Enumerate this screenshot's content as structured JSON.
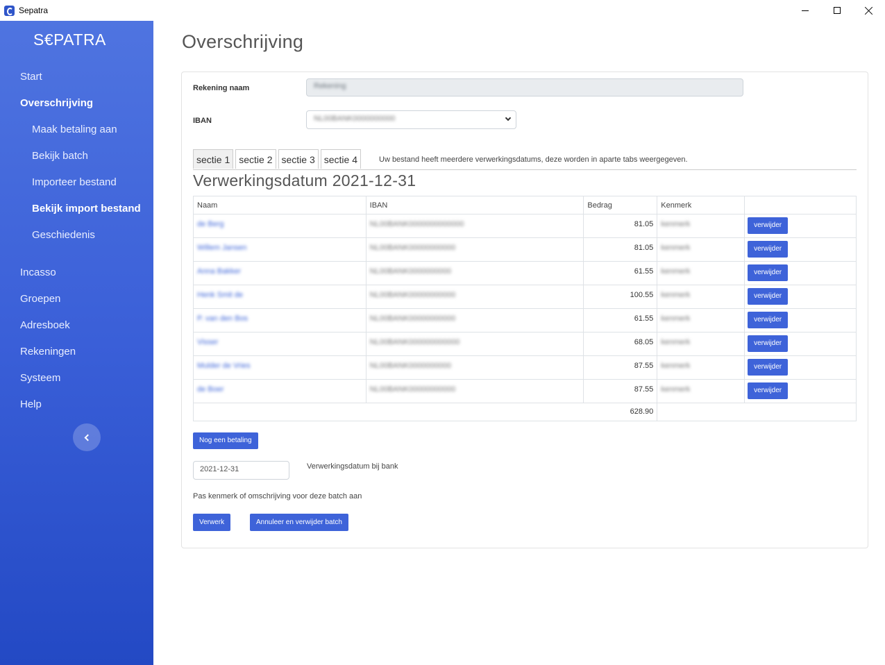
{
  "window": {
    "title": "Sepatra"
  },
  "sidebar": {
    "brand": "S€PATRA",
    "items": [
      {
        "label": "Start"
      },
      {
        "label": "Overschrijving"
      },
      {
        "label": "Maak betaling aan"
      },
      {
        "label": "Bekijk batch"
      },
      {
        "label": "Importeer bestand"
      },
      {
        "label": "Bekijk import bestand"
      },
      {
        "label": "Geschiedenis"
      },
      {
        "label": "Incasso"
      },
      {
        "label": "Groepen"
      },
      {
        "label": "Adresboek"
      },
      {
        "label": "Rekeningen"
      },
      {
        "label": "Systeem"
      },
      {
        "label": "Help"
      }
    ],
    "active_item": "Bekijk import bestand",
    "collapse_icon": "chevron-left-icon"
  },
  "main": {
    "title": "Overschrijving",
    "account": {
      "name_label": "Rekening naam",
      "name_value": "Rekening",
      "iban_label": "IBAN",
      "iban_value": "NL00BANK0000000000"
    },
    "tabs": [
      {
        "label": "sectie 1"
      },
      {
        "label": "sectie 2"
      },
      {
        "label": "sectie 3"
      },
      {
        "label": "sectie 4"
      }
    ],
    "tabs_note": "Uw bestand heeft meerdere verwerkingsdatums, deze worden in aparte tabs weergegeven.",
    "section_title": "Verwerkingsdatum 2021-12-31",
    "table": {
      "headers": [
        "Naam",
        "IBAN",
        "Bedrag",
        "Kenmerk",
        ""
      ],
      "rows": [
        {
          "naam": "de Berg",
          "iban": "NL00BANK0000000000000",
          "bedrag": "81.05",
          "kenmerk": "kenmerk",
          "action": "verwijder"
        },
        {
          "naam": "Willem Jansen",
          "iban": "NL00BANK00000000000",
          "bedrag": "81.05",
          "kenmerk": "kenmerk",
          "action": "verwijder"
        },
        {
          "naam": "Anna Bakker",
          "iban": "NL00BANK0000000000",
          "bedrag": "61.55",
          "kenmerk": "kenmerk",
          "action": "verwijder"
        },
        {
          "naam": "Henk Smit de",
          "iban": "NL00BANK00000000000",
          "bedrag": "100.55",
          "kenmerk": "kenmerk",
          "action": "verwijder"
        },
        {
          "naam": "P. van den Bos",
          "iban": "NL00BANK00000000000",
          "bedrag": "61.55",
          "kenmerk": "kenmerk",
          "action": "verwijder"
        },
        {
          "naam": "Visser",
          "iban": "NL00BANK000000000000",
          "bedrag": "68.05",
          "kenmerk": "kenmerk",
          "action": "verwijder"
        },
        {
          "naam": "Mulder de Vries",
          "iban": "NL00BANK0000000000",
          "bedrag": "87.55",
          "kenmerk": "kenmerk",
          "action": "verwijder"
        },
        {
          "naam": "de Boer",
          "iban": "NL00BANK00000000000",
          "bedrag": "87.55",
          "kenmerk": "kenmerk",
          "action": "verwijder"
        }
      ],
      "total": "628.90"
    },
    "add_payment_button": "Nog een betaling",
    "date_value": "2021-12-31",
    "date_label": "Verwerkingsdatum bij bank",
    "adjust_note": "Pas kenmerk of omschrijving voor deze batch aan",
    "process_button": "Verwerk",
    "cancel_button": "Annuleer en verwijder batch"
  },
  "colors": {
    "accent": "#3e63d9",
    "sidebar_top": "#4f74e0",
    "sidebar_bottom": "#2349c4"
  }
}
